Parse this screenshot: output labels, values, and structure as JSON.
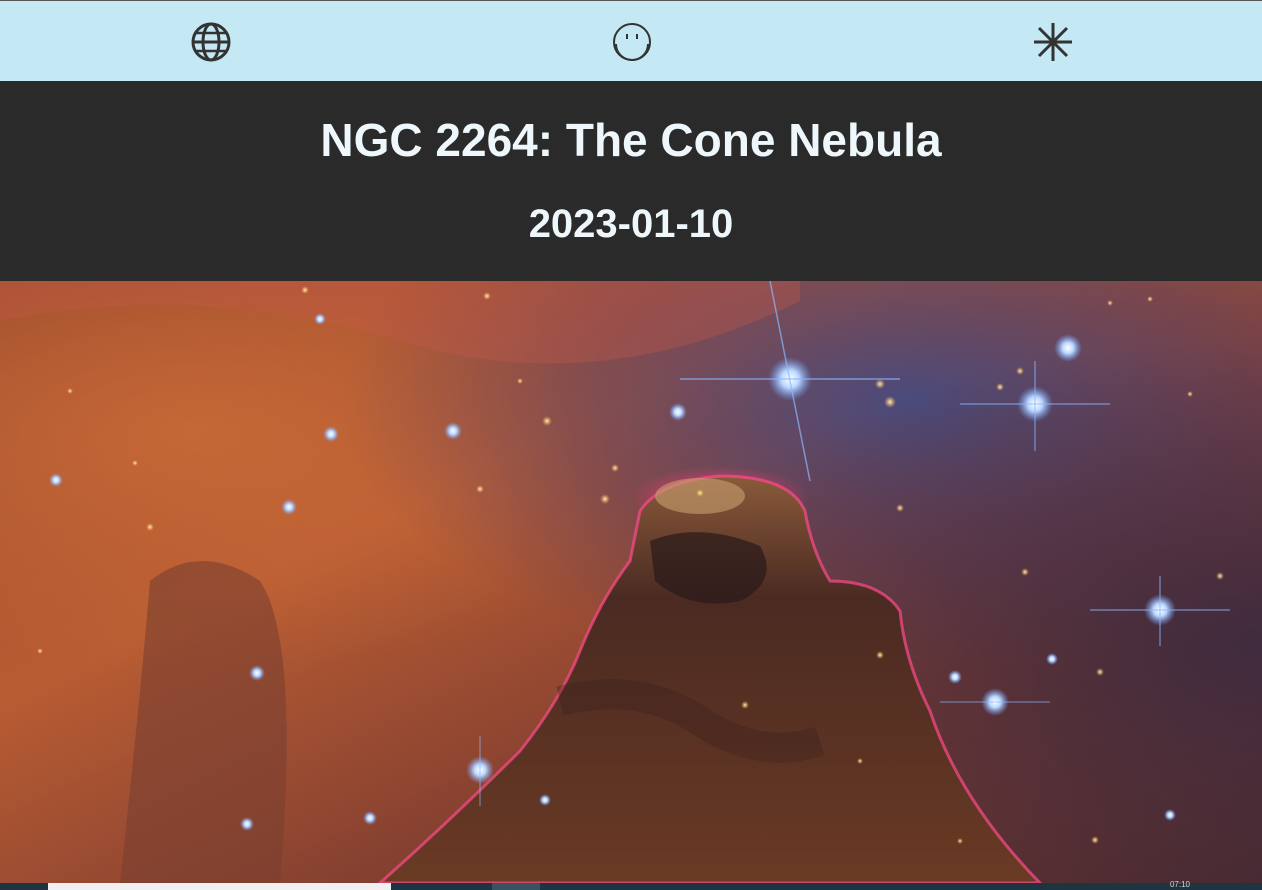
{
  "nav": {
    "icons": [
      "globe-icon",
      "smiley-icon",
      "asterisk-icon"
    ],
    "background": "#c4e8f4"
  },
  "header": {
    "title": "NGC 2264: The Cone Nebula",
    "date": "2023-01-10",
    "background": "#2a2a2a",
    "text_color": "#eef7fb"
  },
  "image": {
    "alt": "NGC 2264: The Cone Nebula"
  },
  "taskbar": {
    "background": "#1e3440",
    "clock": "07:10"
  }
}
